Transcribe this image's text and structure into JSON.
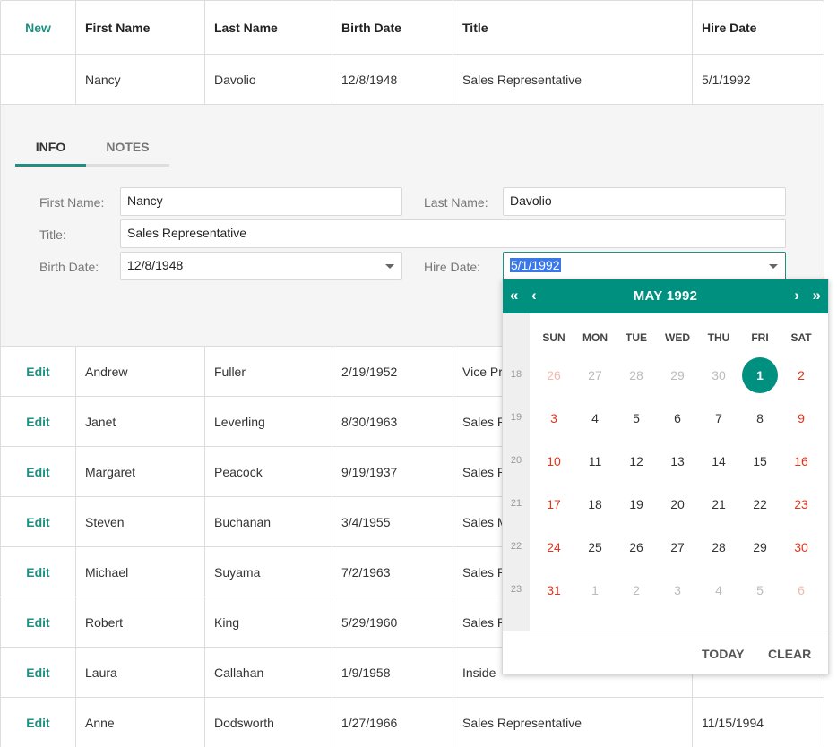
{
  "grid": {
    "header": {
      "new_label": "New",
      "columns": [
        "First Name",
        "Last Name",
        "Birth Date",
        "Title",
        "Hire Date"
      ]
    },
    "editing_row": [
      "Nancy",
      "Davolio",
      "12/8/1948",
      "Sales Representative",
      "5/1/1992"
    ],
    "rows": [
      {
        "action": "Edit",
        "first": "Andrew",
        "last": "Fuller",
        "birth": "2/19/1952",
        "title": "Vice Pr",
        "hire": ""
      },
      {
        "action": "Edit",
        "first": "Janet",
        "last": "Leverling",
        "birth": "8/30/1963",
        "title": "Sales R",
        "hire": ""
      },
      {
        "action": "Edit",
        "first": "Margaret",
        "last": "Peacock",
        "birth": "9/19/1937",
        "title": "Sales R",
        "hire": ""
      },
      {
        "action": "Edit",
        "first": "Steven",
        "last": "Buchanan",
        "birth": "3/4/1955",
        "title": "Sales M",
        "hire": ""
      },
      {
        "action": "Edit",
        "first": "Michael",
        "last": "Suyama",
        "birth": "7/2/1963",
        "title": "Sales R",
        "hire": ""
      },
      {
        "action": "Edit",
        "first": "Robert",
        "last": "King",
        "birth": "5/29/1960",
        "title": "Sales R",
        "hire": ""
      },
      {
        "action": "Edit",
        "first": "Laura",
        "last": "Callahan",
        "birth": "1/9/1958",
        "title": "Inside",
        "hire": ""
      },
      {
        "action": "Edit",
        "first": "Anne",
        "last": "Dodsworth",
        "birth": "1/27/1966",
        "title": "Sales Representative",
        "hire": "11/15/1994"
      }
    ]
  },
  "detail": {
    "tabs": [
      "INFO",
      "NOTES"
    ],
    "active_tab": "INFO",
    "labels": {
      "first_name": "First Name:",
      "last_name": "Last Name:",
      "title": "Title:",
      "birth_date": "Birth Date:",
      "hire_date": "Hire Date:"
    },
    "values": {
      "first_name": "Nancy",
      "last_name": "Davolio",
      "title": "Sales Representative",
      "birth_date": "12/8/1948",
      "hire_date": "5/1/1992"
    }
  },
  "calendar": {
    "title": "MAY 1992",
    "nav_icons": [
      "double-chevron-left-icon",
      "chevron-left-icon",
      "chevron-right-icon",
      "double-chevron-right-icon"
    ],
    "nav_glyphs": {
      "prev_year": "«",
      "prev_month": "‹",
      "next_month": "›",
      "next_year": "»"
    },
    "weekdays": [
      "SUN",
      "MON",
      "TUE",
      "WED",
      "THU",
      "FRI",
      "SAT"
    ],
    "weeks": [
      {
        "num": "18",
        "days": [
          "26",
          "27",
          "28",
          "29",
          "30",
          "1",
          "2"
        ]
      },
      {
        "num": "19",
        "days": [
          "3",
          "4",
          "5",
          "6",
          "7",
          "8",
          "9"
        ]
      },
      {
        "num": "20",
        "days": [
          "10",
          "11",
          "12",
          "13",
          "14",
          "15",
          "16"
        ]
      },
      {
        "num": "21",
        "days": [
          "17",
          "18",
          "19",
          "20",
          "21",
          "22",
          "23"
        ]
      },
      {
        "num": "22",
        "days": [
          "24",
          "25",
          "26",
          "27",
          "28",
          "29",
          "30"
        ]
      },
      {
        "num": "23",
        "days": [
          "31",
          "1",
          "2",
          "3",
          "4",
          "5",
          "6"
        ]
      }
    ],
    "selected_day": "1",
    "footer": {
      "today": "TODAY",
      "clear": "CLEAR"
    },
    "colors": {
      "accent": "#00907f",
      "weekend": "#e0341b"
    }
  }
}
